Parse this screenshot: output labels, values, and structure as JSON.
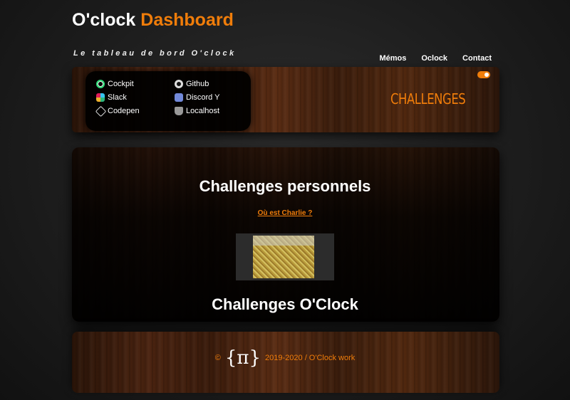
{
  "header": {
    "title_part1": "O'clock",
    "title_part2": "Dashboard",
    "subtitle": "Le tableau de bord O'clock",
    "nav": [
      {
        "label": "Mémos"
      },
      {
        "label": "Oclock"
      },
      {
        "label": "Contact"
      }
    ],
    "theme_toggle": {
      "state": "on",
      "color": "#f07d0a"
    },
    "logo_text": "CHALLENGES"
  },
  "links": [
    {
      "label": "Cockpit",
      "icon": "cockpit-icon"
    },
    {
      "label": "Slack",
      "icon": "slack-icon"
    },
    {
      "label": "Codepen",
      "icon": "codepen-icon"
    },
    {
      "label": "Github",
      "icon": "github-icon"
    },
    {
      "label": "Discord Y",
      "icon": "discord-icon"
    },
    {
      "label": "Localhost",
      "icon": "localhost-icon"
    }
  ],
  "main": {
    "section1_title": "Challenges personnels",
    "challenge_link": "Où est Charlie ?",
    "section2_title": "Challenges O'Clock"
  },
  "footer": {
    "copyright": "©",
    "logo_symbol": "{π}",
    "text": "2019-2020 / O'Clock work"
  },
  "colors": {
    "accent": "#f07d0a",
    "background": "#1d1d1d"
  }
}
